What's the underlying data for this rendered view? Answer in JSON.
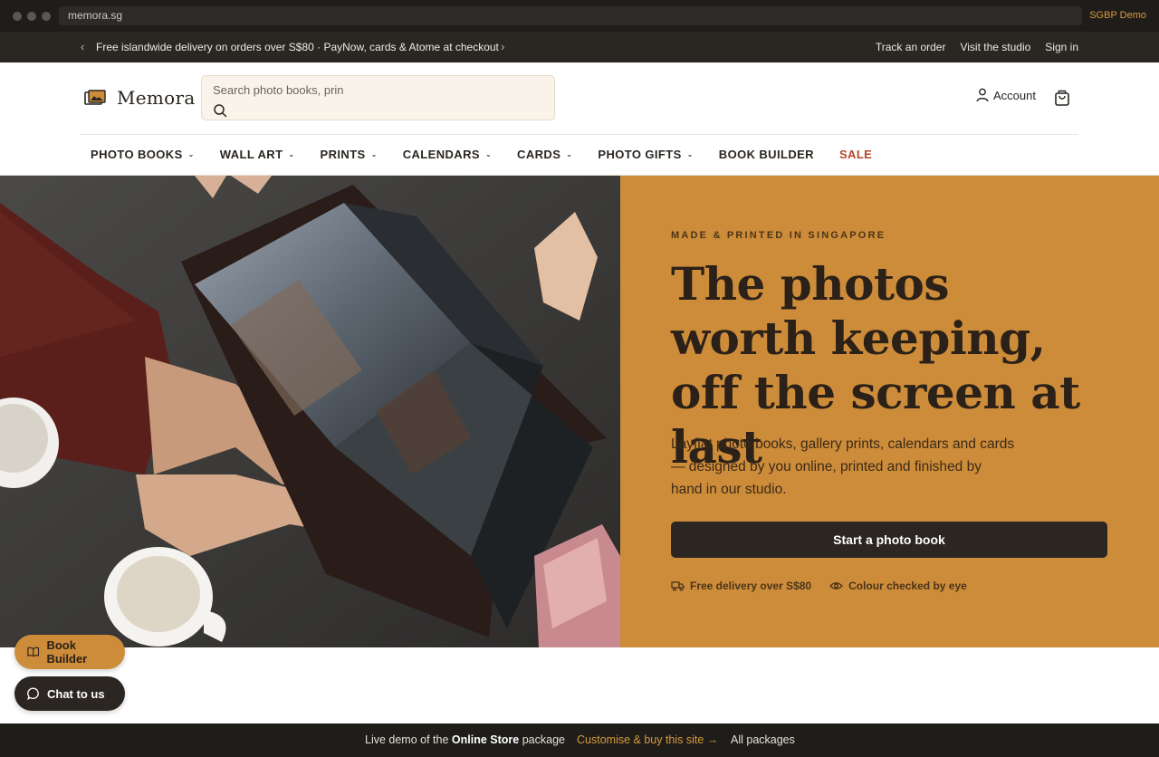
{
  "browser": {
    "url": "memora.sg",
    "demo_tag": "SGBP Demo"
  },
  "announcement": {
    "prev": "‹",
    "next": "›",
    "message": "Free islandwide delivery on orders over S$80 · PayNow, cards & Atome at checkout",
    "links": [
      "Track an order",
      "Visit the studio",
      "Sign in"
    ]
  },
  "header": {
    "brand": "Memora",
    "search_placeholder": "Search photo books, prin",
    "account_label": "Account"
  },
  "nav": {
    "items": [
      {
        "label": "PHOTO BOOKS",
        "chevron": "⌄"
      },
      {
        "label": "WALL ART",
        "chevron": "⌄"
      },
      {
        "label": "PRINTS",
        "chevron": "⌄"
      },
      {
        "label": "CALENDARS",
        "chevron": "⌄"
      },
      {
        "label": "CARDS",
        "chevron": "⌄"
      },
      {
        "label": "PHOTO GIFTS",
        "chevron": "⌄"
      },
      {
        "label": "BOOK BUILDER",
        "chevron": ""
      },
      {
        "label": "SALE",
        "chevron": ""
      }
    ]
  },
  "hero": {
    "eyebrow": "MADE & PRINTED IN SINGAPORE",
    "headline": "The photos worth keeping, off the screen at last",
    "lede": "Layflat photo books, gallery prints, calendars and cards — designed by you online, printed and finished by hand in our studio.",
    "cta": "Start a photo book",
    "perks": [
      "Free delivery over S$80",
      "Colour checked by eye"
    ]
  },
  "floating": {
    "builder": "Book Builder",
    "chat": "Chat to us"
  },
  "demo_bar": {
    "prefix": "Live demo of the",
    "package": "Online Store",
    "suffix": "package",
    "customise": "Customise & buy this site →",
    "all": "All packages"
  },
  "colors": {
    "accent": "#cd8c3a",
    "dark": "#2b2622",
    "sale": "#b5482a"
  }
}
